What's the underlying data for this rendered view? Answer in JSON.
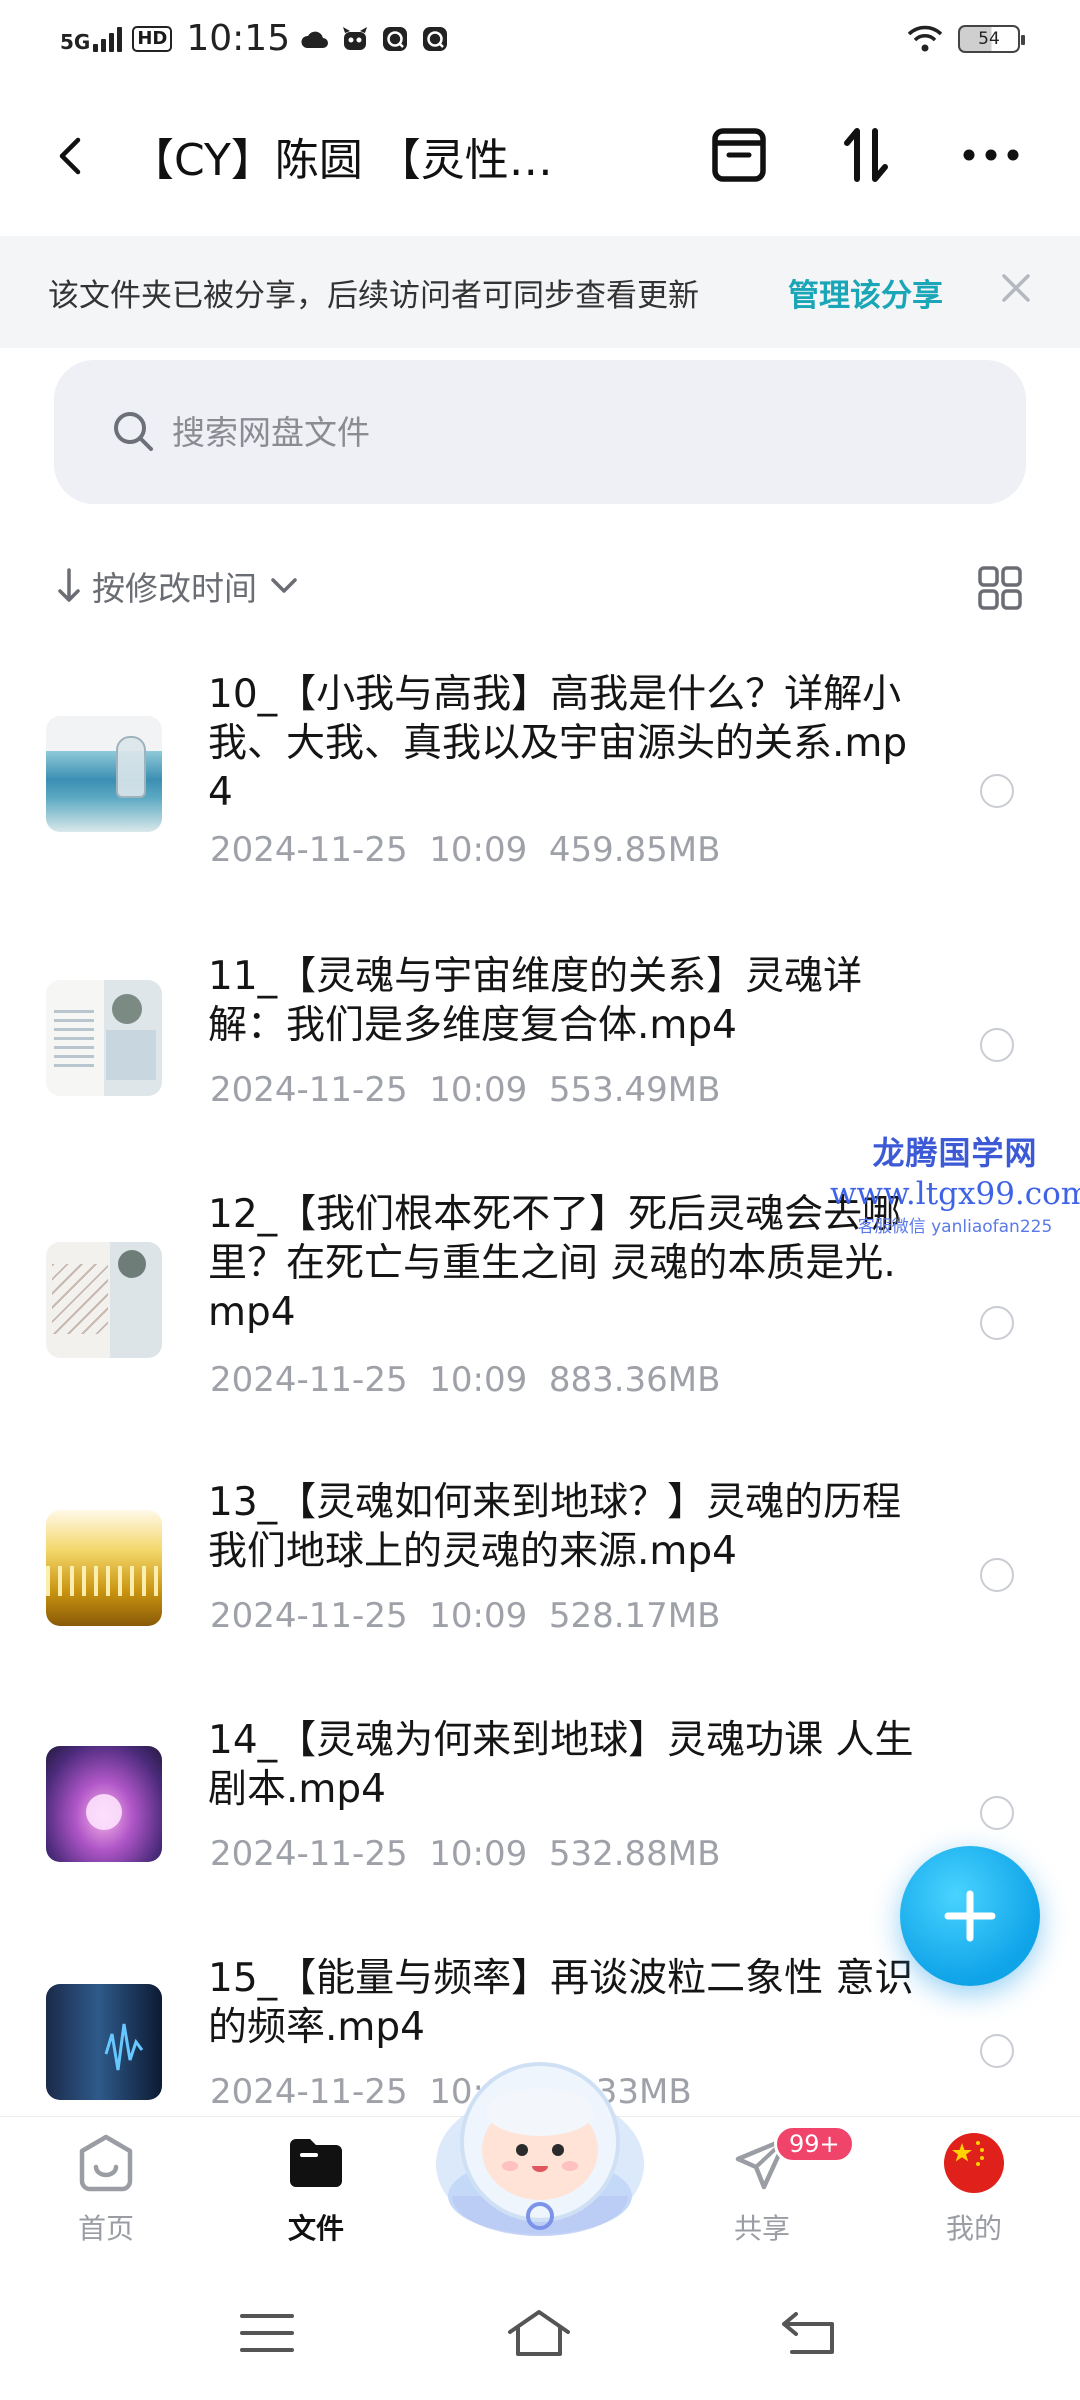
{
  "status_bar": {
    "network": "5G",
    "hd": "HD",
    "time": "10:15",
    "battery": "54"
  },
  "header": {
    "title": "【CY】陈圆 【灵性…"
  },
  "banner": {
    "text": "该文件夹已被分享，后续访问者可同步查看更新",
    "link": "管理该分享"
  },
  "search": {
    "placeholder": "搜索网盘文件"
  },
  "sort": {
    "label": "按修改时间"
  },
  "files": [
    {
      "name": "10_【小我与高我】高我是什么？详解小我、大我、真我以及宇宙源头的关系.mp4",
      "date": "2024-11-25",
      "time": "10:09",
      "size": "459.85MB"
    },
    {
      "name": "11_【灵魂与宇宙维度的关系】灵魂详解：我们是多维度复合体.mp4",
      "date": "2024-11-25",
      "time": "10:09",
      "size": "553.49MB"
    },
    {
      "name": "12_【我们根本死不了】死后灵魂会去哪里？在死亡与重生之间 灵魂的本质是光.mp4",
      "date": "2024-11-25",
      "time": "10:09",
      "size": "883.36MB"
    },
    {
      "name": "13_【灵魂如何来到地球？】灵魂的历程 我们地球上的灵魂的来源.mp4",
      "date": "2024-11-25",
      "time": "10:09",
      "size": "528.17MB"
    },
    {
      "name": "14_【灵魂为何来到地球】灵魂功课 人生剧本.mp4",
      "date": "2024-11-25",
      "time": "10:09",
      "size": "532.88MB"
    },
    {
      "name": "15_【能量与频率】再谈波粒二象性 意识的频率.mp4",
      "date": "2024-11-25",
      "time": "10:09",
      "size": "??.33MB"
    }
  ],
  "watermark": {
    "line1": "龙腾国学网",
    "line2": "www.ltgx99.com",
    "line3": "客服微信 yanliaofan225"
  },
  "bottom_nav": [
    {
      "label": "首页",
      "icon": "home-icon"
    },
    {
      "label": "文件",
      "icon": "folder-icon"
    },
    {
      "label": "共享",
      "icon": "paper-plane-icon",
      "badge": "99+"
    },
    {
      "label": "我的",
      "icon": "china-flag-avatar-icon"
    }
  ],
  "colors": {
    "accent": "#1aa6b7",
    "fab": "#0fa3e8",
    "badge": "#f0446a"
  }
}
